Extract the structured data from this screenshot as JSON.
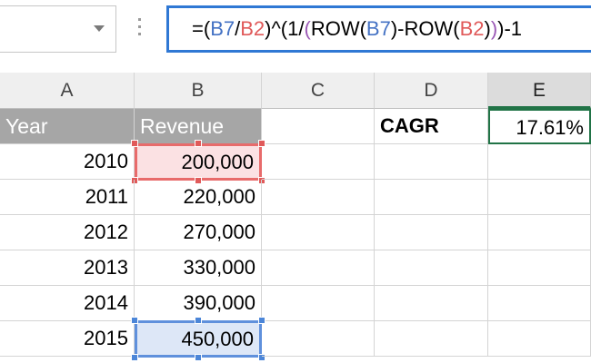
{
  "formula_bar": {
    "name_box_value": "",
    "formula_parts": [
      {
        "text": "=(",
        "kind": "plain"
      },
      {
        "text": "B7",
        "kind": "ref-blue"
      },
      {
        "text": "/",
        "kind": "plain"
      },
      {
        "text": "B2",
        "kind": "ref-red"
      },
      {
        "text": ")^(1/",
        "kind": "plain"
      },
      {
        "text": "(",
        "kind": "paren-purple"
      },
      {
        "text": "ROW(",
        "kind": "plain"
      },
      {
        "text": "B7",
        "kind": "ref-blue"
      },
      {
        "text": ")-ROW(",
        "kind": "plain"
      },
      {
        "text": "B2",
        "kind": "ref-red"
      },
      {
        "text": ")",
        "kind": "plain"
      },
      {
        "text": ")",
        "kind": "paren-purple"
      },
      {
        "text": ")-1",
        "kind": "plain"
      }
    ]
  },
  "columns": [
    "A",
    "B",
    "C",
    "D",
    "E"
  ],
  "selected_column": "E",
  "table": {
    "header_year": "Year",
    "header_revenue": "Revenue",
    "rows": [
      {
        "year": "2010",
        "revenue": "200,000"
      },
      {
        "year": "2011",
        "revenue": "220,000"
      },
      {
        "year": "2012",
        "revenue": "270,000"
      },
      {
        "year": "2013",
        "revenue": "330,000"
      },
      {
        "year": "2014",
        "revenue": "390,000"
      },
      {
        "year": "2015",
        "revenue": "450,000"
      }
    ]
  },
  "cagr": {
    "label": "CAGR",
    "value": "17.61%"
  },
  "colors": {
    "accent_green": "#217346",
    "formula_border": "#2f78d4",
    "ref_blue": "#4472c4",
    "ref_red": "#e05a5a",
    "header_fill": "#a6a6a6"
  }
}
